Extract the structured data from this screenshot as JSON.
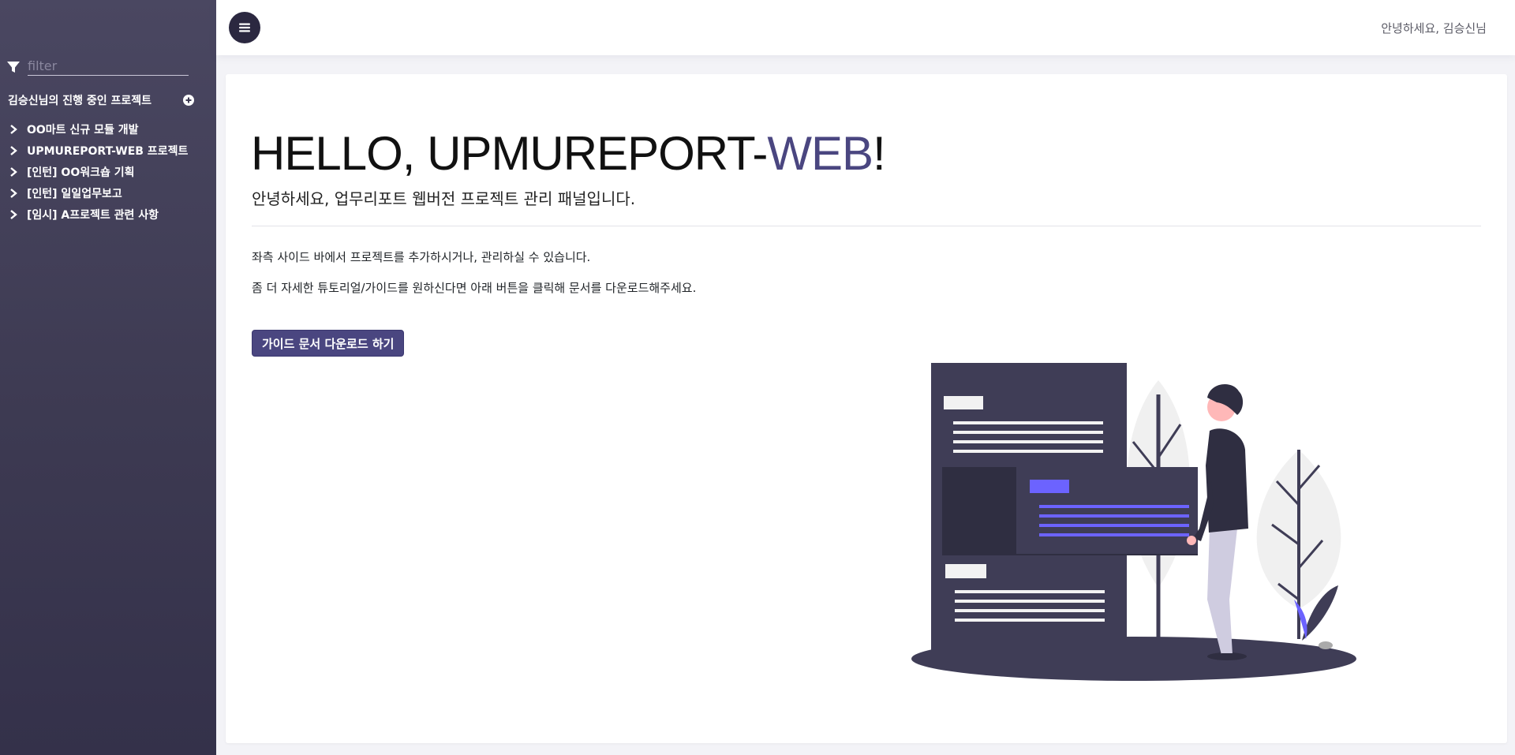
{
  "sidebar": {
    "filter_placeholder": "filter",
    "section_title": "김승신님의 진행 중인 프로젝트",
    "projects": [
      {
        "label": "OO마트 신규 모듈 개발"
      },
      {
        "label": "UPMUREPORT-WEB 프로젝트"
      },
      {
        "label": "[인턴] OO워크숍 기획"
      },
      {
        "label": "[인턴] 일일업무보고"
      },
      {
        "label": "[임시] A프로젝트 관련 사항"
      }
    ]
  },
  "header": {
    "greeting": "안녕하세요, 김승신님"
  },
  "main": {
    "hello_prefix": "HELLO, UPMUREPORT-",
    "hello_accent": "WEB",
    "hello_suffix": "!",
    "subtitle": "안녕하세요, 업무리포트 웹버전 프로젝트 관리 패널입니다.",
    "description_1": "좌측 사이드 바에서 프로젝트를 추가하시거나, 관리하실 수 있습니다.",
    "description_2": "좀 더 자세한 튜토리얼/가이드를 원하신다면 아래 버튼을 클릭해 문서를 다운로드해주세요.",
    "guide_button_label": "가이드 문서 다운로드 하기"
  },
  "colors": {
    "sidebar_bg": "#3d3a52",
    "accent": "#4a4680",
    "illustration_highlight": "#6c63ff"
  }
}
